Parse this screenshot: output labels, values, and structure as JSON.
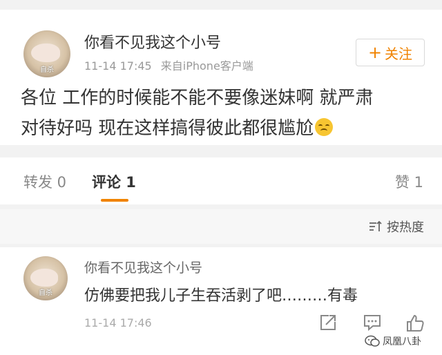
{
  "post": {
    "username": "你看不见我这个小号",
    "time": "11-14 17:45",
    "source": "来自iPhone客户端",
    "follow_label": "关注",
    "text_line1": "各位 工作的时候能不能不要像迷妹啊 就严肃",
    "text_line2": "对待好吗 现在这样搞得彼此都很尴尬",
    "avatar_watermark": "自杀"
  },
  "tabs": {
    "repost": "转发 0",
    "comments": "评论 1",
    "likes": "赞 1"
  },
  "sort": {
    "label": "按热度"
  },
  "comment": {
    "username": "你看不见我这个小号",
    "text": "仿佛要把我儿子生吞活剥了吧………有毒",
    "time": "11-14 17:46",
    "avatar_watermark": "自杀"
  },
  "watermark": {
    "text": "凤凰八卦"
  },
  "colors": {
    "accent": "#f08300",
    "muted": "#999999",
    "text": "#333333"
  }
}
